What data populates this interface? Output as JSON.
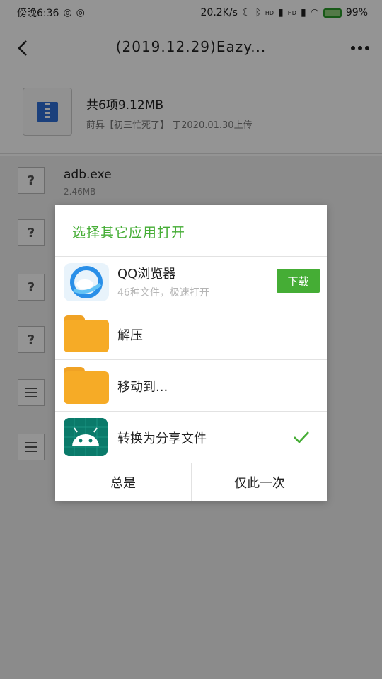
{
  "status_bar": {
    "left_text": "傍晚6:36",
    "speed": "20.2K/s",
    "signal_labels": [
      "HD",
      "HD"
    ],
    "battery": "99%"
  },
  "header": {
    "title": "(2019.12.29)Eazy..."
  },
  "summary": {
    "title": "共6项9.12MB",
    "subtitle": "莳昇【初三忙死了】 于2020.01.30上传"
  },
  "files": [
    {
      "icon": "question-file-icon",
      "glyph": "?",
      "name": "adb.exe",
      "size": "2.46MB"
    },
    {
      "icon": "question-file-icon",
      "glyph": "?"
    },
    {
      "icon": "question-file-icon",
      "glyph": "?"
    },
    {
      "icon": "question-file-icon",
      "glyph": "?"
    },
    {
      "icon": "text-file-icon"
    },
    {
      "icon": "text-file-icon"
    }
  ],
  "dialog": {
    "title": "选择其它应用打开",
    "apps": [
      {
        "name": "QQ浏览器",
        "subtitle": "46种文件，极速打开",
        "action": "下载",
        "icon": "qq-browser-icon"
      },
      {
        "name": "解压",
        "icon": "folder-icon"
      },
      {
        "name": "移动到...",
        "icon": "folder-icon"
      },
      {
        "name": "转换为分享文件",
        "icon": "android-icon",
        "selected": true
      }
    ],
    "always_label": "总是",
    "once_label": "仅此一次"
  },
  "colors": {
    "accent": "#45ad35",
    "folder": "#f6ab26",
    "android_tile": "#0a7a6a",
    "overlay": "rgba(0,0,0,0.42)"
  }
}
